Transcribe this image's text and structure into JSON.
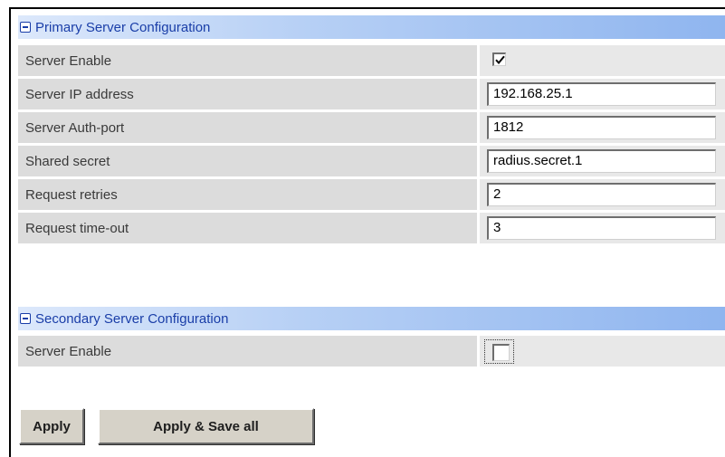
{
  "primary": {
    "title": "Primary Server Configuration",
    "rows": [
      {
        "label": "Server Enable",
        "type": "checkbox",
        "checked": true
      },
      {
        "label": "Server IP address",
        "type": "text",
        "value": "192.168.25.1"
      },
      {
        "label": "Server Auth-port",
        "type": "text",
        "value": "1812"
      },
      {
        "label": "Shared secret",
        "type": "text",
        "value": "radius.secret.1"
      },
      {
        "label": "Request retries",
        "type": "text",
        "value": "2"
      },
      {
        "label": "Request time-out",
        "type": "text",
        "value": "3"
      }
    ]
  },
  "secondary": {
    "title": "Secondary Server Configuration",
    "rows": [
      {
        "label": "Server Enable",
        "type": "checkbox",
        "checked": false
      }
    ]
  },
  "buttons": {
    "apply_label": "Apply",
    "apply_save_label": "Apply & Save all"
  },
  "colors": {
    "header_text": "#1a3ea8",
    "label_bg": "#dcdcdc",
    "value_bg": "#e8e8e8",
    "button_bg": "#d6d2c8"
  }
}
